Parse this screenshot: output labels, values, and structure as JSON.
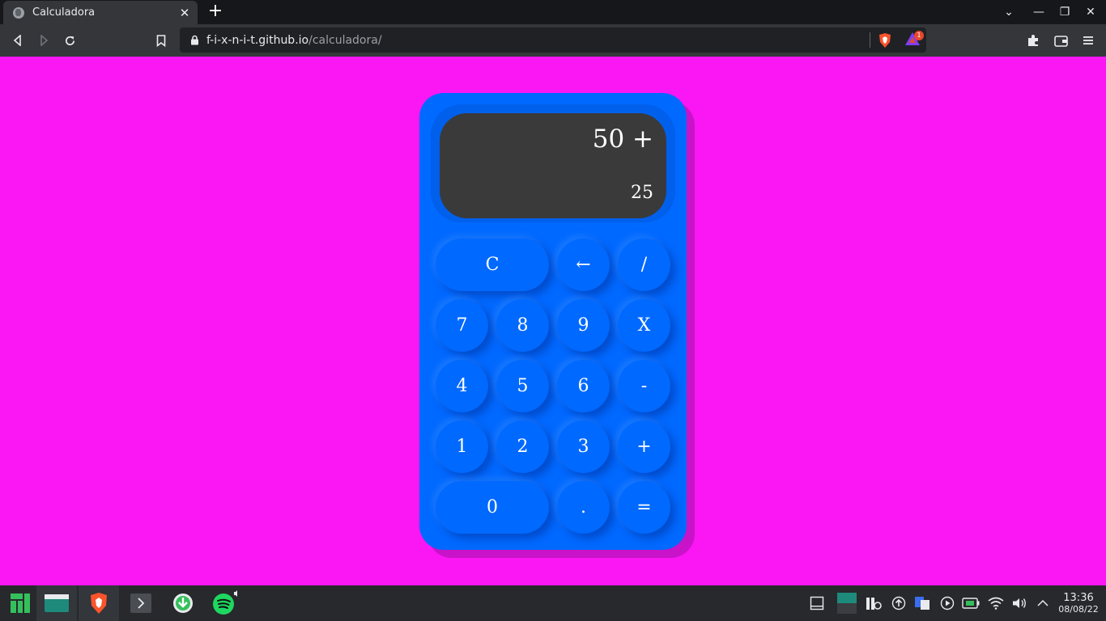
{
  "browser": {
    "tab": {
      "title": "Calculadora",
      "close": "✕"
    },
    "new_tab": "+",
    "window_controls": {
      "list": "⌄",
      "minimize": "—",
      "maximize": "❐",
      "close": "✕"
    },
    "url": {
      "host": "f-i-x-n-i-t.github.io",
      "path": "/calculadora/"
    },
    "rewards_badge": "1"
  },
  "calculator": {
    "display": {
      "expression": "50 +",
      "current": "25"
    },
    "rows": [
      [
        "C",
        "←",
        "/"
      ],
      [
        "7",
        "8",
        "9",
        "X"
      ],
      [
        "4",
        "5",
        "6",
        "-"
      ],
      [
        "1",
        "2",
        "3",
        "+"
      ],
      [
        "0",
        ".",
        "="
      ]
    ]
  },
  "taskbar": {
    "clock": {
      "time": "13:36",
      "date": "08/08/22"
    }
  },
  "colors": {
    "page_background": "#fb16f4",
    "calculator_body": "#0069ff",
    "calculator_shadow": "#c813c9",
    "display_background": "#3a3a3a",
    "taskbar_background": "#27292c"
  }
}
